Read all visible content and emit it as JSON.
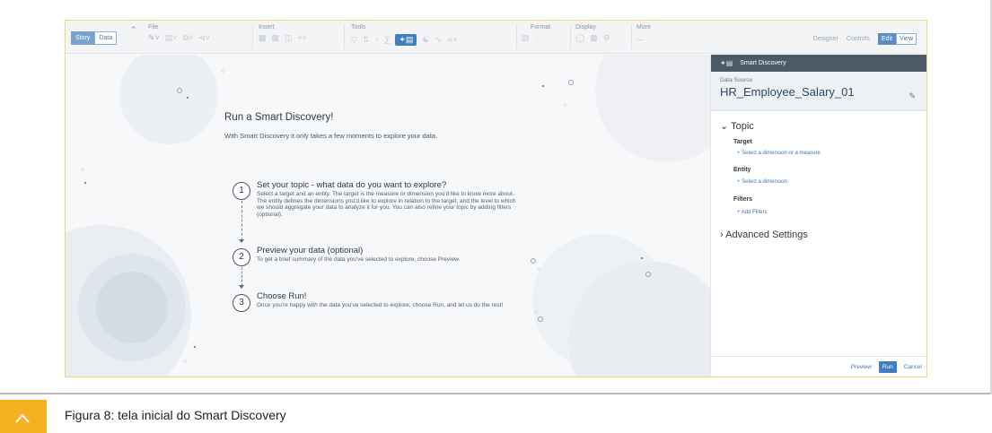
{
  "toolbar": {
    "story_label": "Story",
    "data_label": "Data",
    "groups": {
      "file": "File",
      "insert": "Insert",
      "tools": "Tools",
      "format": "Format",
      "display": "Display",
      "more": "More"
    },
    "more_ellipsis": "...",
    "modes": {
      "designer": "Designer",
      "controls": "Controls",
      "edit": "Edit",
      "view": "View"
    }
  },
  "canvas": {
    "title": "Run a Smart Discovery!",
    "intro": "With Smart Discovery it only takes a few moments to explore your data.",
    "steps": [
      {
        "number": "1",
        "title": "Set your topic - what data do you want to explore?",
        "desc_lines": [
          "Select a target and an entity. The target is the measure or dimension you'd like to know more about.",
          "The entity defines the dimensions you'd like to explore in relation to the target, and the level to which",
          "we should aggregate your data to analyze it for you. You can also refine your topic by adding filters",
          "(optional)."
        ]
      },
      {
        "number": "2",
        "title": "Preview your data (optional)",
        "desc_lines": [
          "To get a brief summary of the data you've selected to explore, choose Preview."
        ]
      },
      {
        "number": "3",
        "title": "Choose Run!",
        "desc_lines": [
          "Once you're happy with the data you've selected to explore, choose Run, and let us do the rest!"
        ]
      }
    ]
  },
  "panel": {
    "title": "Smart Discovery",
    "data_source_label": "Data Source",
    "data_source_value": "HR_Employee_Salary_01",
    "topic_label": "Topic",
    "target_label": "Target",
    "target_link": "+ Select a dimension or a measure",
    "entity_label": "Entity",
    "entity_link": "+ Select a dimension",
    "filters_label": "Filters",
    "filters_link": "+ Add Filters",
    "advanced_label": "Advanced Settings",
    "footer": {
      "preview": "Preview",
      "run": "Run",
      "cancel": "Cancel"
    }
  },
  "caption": {
    "text": "Figura 8: tela inicial do Smart Discovery"
  },
  "colors": {
    "accent_yellow": "#f4b222",
    "sap_blue": "#3f7fbf",
    "panel_header": "#4c5966"
  }
}
